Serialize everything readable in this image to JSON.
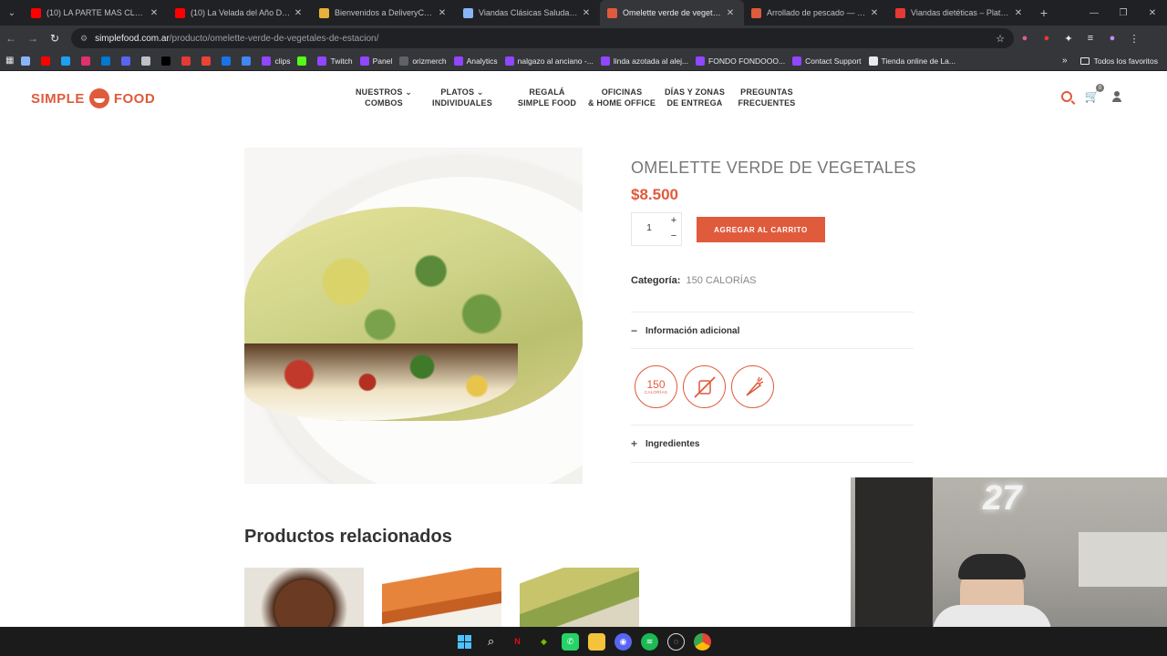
{
  "browser": {
    "tabs": [
      {
        "title": "(10) LA PARTE MAS CLASISTA D",
        "fav_color": "#ff0000",
        "active": false
      },
      {
        "title": "(10) La Velada del Año Desde A",
        "fav_color": "#ff0000",
        "active": false
      },
      {
        "title": "Bienvenidos a DeliveryCormillo",
        "fav_color": "#e8b13a",
        "active": false
      },
      {
        "title": "Viandas Clásicas Saludables - S",
        "fav_color": "#8ab4f8",
        "active": false
      },
      {
        "title": "Omelette verde de vegetales —",
        "fav_color": "#e05a3c",
        "active": true
      },
      {
        "title": "Arrollado de pescado — vianda",
        "fav_color": "#e05a3c",
        "active": false
      },
      {
        "title": "Viandas dietéticas – Platos ~15",
        "fav_color": "#e53935",
        "active": false
      }
    ],
    "new_tab": "+",
    "url_host": "simplefood.com.ar",
    "url_path": "/producto/omelette-verde-de-vegetales-de-estacion/",
    "bookmarks": [
      {
        "label": "",
        "color": "#8ab4f8"
      },
      {
        "label": "",
        "color": "#ff0000"
      },
      {
        "label": "",
        "color": "#1da1f2"
      },
      {
        "label": "",
        "color": "#e1306c"
      },
      {
        "label": "",
        "color": "#0079d3"
      },
      {
        "label": "",
        "color": "#5865f2"
      },
      {
        "label": "",
        "color": "#bdc1c6"
      },
      {
        "label": "",
        "color": "#000000"
      },
      {
        "label": "",
        "color": "#e53935"
      },
      {
        "label": "",
        "color": "#ea4335"
      },
      {
        "label": "",
        "color": "#1a73e8"
      },
      {
        "label": "",
        "color": "#4285f4"
      },
      {
        "label": "clips",
        "color": "#9146ff"
      },
      {
        "label": "",
        "color": "#53fc18"
      },
      {
        "label": "Twitch",
        "color": "#9146ff"
      },
      {
        "label": "Panel",
        "color": "#9146ff"
      },
      {
        "label": "orizmerch",
        "color": "#5f6368"
      },
      {
        "label": "Analytics",
        "color": "#9146ff"
      },
      {
        "label": "nalgazo al anciano -...",
        "color": "#9146ff"
      },
      {
        "label": "linda azotada al alej...",
        "color": "#9146ff"
      },
      {
        "label": "FONDO FONDOOO...",
        "color": "#9146ff"
      },
      {
        "label": "Contact Support",
        "color": "#9146ff"
      },
      {
        "label": "Tienda online de La...",
        "color": "#e8eaed"
      }
    ],
    "bookmarks_more": "»",
    "all_bookmarks": "Todos los favoritos"
  },
  "site": {
    "logo_left": "SIMPLE",
    "logo_right": "FOOD",
    "nav": [
      {
        "line1": "NUESTROS ⌄",
        "line2": "COMBOS"
      },
      {
        "line1": "PLATOS ⌄",
        "line2": "INDIVIDUALES"
      },
      {
        "line1": "REGALÁ",
        "line2": "SIMPLE FOOD"
      },
      {
        "line1": "OFICINAS",
        "line2": "& HOME OFFICE"
      },
      {
        "line1": "DÍAS Y ZONAS",
        "line2": "DE ENTREGA"
      },
      {
        "line1": "PREGUNTAS",
        "line2": "FRECUENTES"
      }
    ],
    "cart_count": "0"
  },
  "product": {
    "title": "OMELETTE VERDE DE VEGETALES",
    "price": "$8.500",
    "qty": "1",
    "qty_plus": "+",
    "qty_minus": "−",
    "add_to_cart": "AGREGAR AL CARRITO",
    "category_label": "Categoría:",
    "category_value": "150 CALORÍAS",
    "acc_info": "Información adicional",
    "acc_info_sign": "−",
    "acc_ingredients": "Ingredientes",
    "acc_ingredients_sign": "+",
    "badge_calories": "150",
    "badge_calories_sub": "CALORÍAS"
  },
  "related": {
    "title": "Productos relacionados"
  },
  "colors": {
    "brand": "#e05a3c"
  }
}
